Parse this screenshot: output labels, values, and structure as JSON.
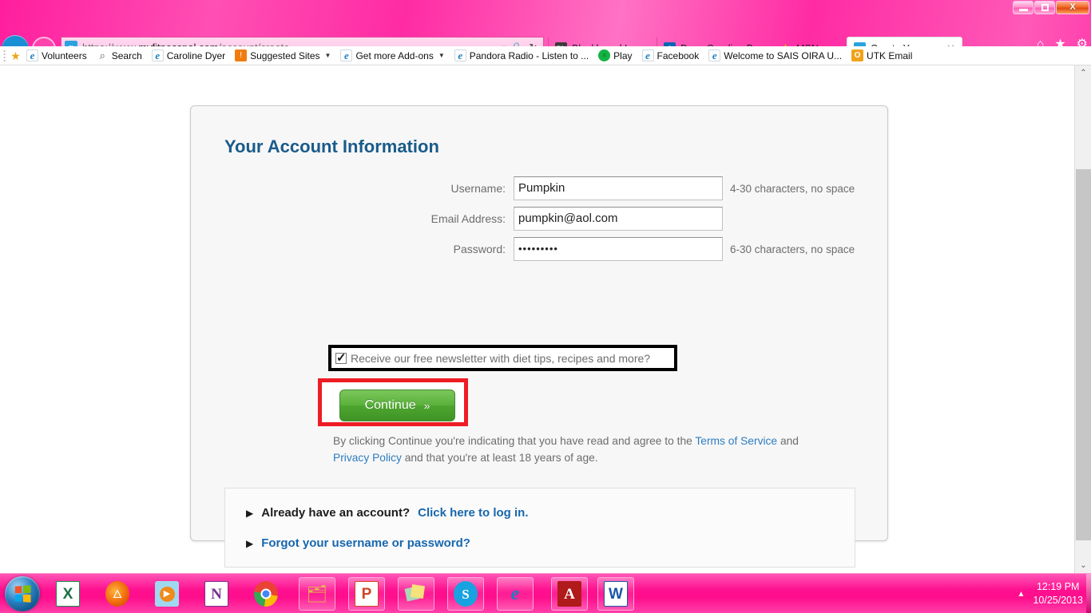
{
  "window": {
    "minimize_label": "Minimize",
    "maximize_label": "Restore",
    "close_label": "X"
  },
  "browser": {
    "back_label": "←",
    "forward_label": "→",
    "address": {
      "scheme": "https://www.",
      "host": "myfitnesspal.com",
      "path": "/account/create",
      "full": "https://www.myfitnesspal.com/account/create",
      "favicon_letter": "x",
      "search_icon": "⌕",
      "search_caret": "▼",
      "lock_icon": "🔒",
      "refresh_icon": "↻"
    },
    "tabs": [
      {
        "label": "Blackboard Learn",
        "favicon": "blackboard-icon",
        "favicon_letter": "Bb",
        "active": false
      },
      {
        "label": "Dyer, Caroline Beth ...",
        "favicon": "outlook-icon",
        "favicon_letter": "O",
        "active": false
      },
      {
        "label": "MSN.com",
        "favicon": "msn-butterfly-icon",
        "favicon_letter": "✦",
        "active": false
      },
      {
        "label": "Create Your Free ...",
        "favicon": "myfitnesspal-icon",
        "favicon_letter": "x",
        "active": true,
        "close_label": "✕"
      }
    ],
    "toolbar_icons": [
      {
        "name": "home-icon",
        "glyph": "⌂"
      },
      {
        "name": "favorites-star-icon",
        "glyph": "★"
      },
      {
        "name": "tools-gear-icon",
        "glyph": "⚙"
      }
    ],
    "bookmarks": [
      {
        "label": "Volunteers",
        "icon": "ie-page-icon",
        "glyph": "e",
        "icon_class": "ico-ie",
        "caret": false,
        "star": true
      },
      {
        "label": "Search",
        "icon": "magnifier-icon",
        "glyph": "⌕",
        "icon_class": "ico-mag",
        "caret": false
      },
      {
        "label": "Caroline Dyer",
        "icon": "ie-page-icon",
        "glyph": "e",
        "icon_class": "ico-ie",
        "caret": false
      },
      {
        "label": "Suggested Sites",
        "icon": "lightbulb-icon",
        "glyph": "!",
        "icon_class": "ico-bulb",
        "caret": true
      },
      {
        "label": "Get more Add-ons",
        "icon": "ie-page-icon",
        "glyph": "e",
        "icon_class": "ico-ie",
        "caret": true
      },
      {
        "label": "Pandora Radio - Listen to ...",
        "icon": "ie-page-icon",
        "glyph": "e",
        "icon_class": "ico-ie",
        "caret": false
      },
      {
        "label": "Play",
        "icon": "spotify-icon",
        "glyph": "≡",
        "icon_class": "ico-spot",
        "caret": false
      },
      {
        "label": "Facebook",
        "icon": "ie-page-icon",
        "glyph": "e",
        "icon_class": "ico-ie",
        "caret": false
      },
      {
        "label": "Welcome to SAIS  OIRA U...",
        "icon": "ie-page-icon",
        "glyph": "e",
        "icon_class": "ico-ie",
        "caret": false
      },
      {
        "label": "UTK Email",
        "icon": "outlook-icon",
        "glyph": "O",
        "icon_class": "ico-out",
        "caret": false
      }
    ]
  },
  "page": {
    "title": "Your Account Information",
    "fields": [
      {
        "label": "Username:",
        "value": "Pumpkin",
        "placeholder": "",
        "hint": "4-30 characters, no space",
        "name": "username"
      },
      {
        "label": "Email Address:",
        "value": "pumpkin@aol.com",
        "placeholder": "",
        "hint": "",
        "name": "email"
      },
      {
        "label": "Password:",
        "value": "•••••••••",
        "placeholder": "",
        "hint": "6-30 characters, no space",
        "name": "password"
      }
    ],
    "newsletter": {
      "label": "Receive our free newsletter with diet tips, recipes and more?",
      "checked": true,
      "check_glyph": "✓"
    },
    "continue_button": {
      "label": "Continue",
      "chevron": "»"
    },
    "terms": {
      "part1": "By clicking Continue you're indicating that you have read and agree to the ",
      "link1": "Terms of Service",
      "part2": " and ",
      "link2": "Privacy Policy",
      "part3": " and that you're at least 18 years of age."
    },
    "accordion": [
      {
        "triangle": "▶",
        "text": "Already have an account?",
        "link": "Click here to log in.",
        "name": "already-have-account"
      },
      {
        "triangle": "▶",
        "text": "",
        "link": "Forgot your username or password?",
        "name": "forgot-credentials"
      }
    ],
    "scrollbar": {
      "up_glyph": "⌃",
      "down_glyph": "⌄"
    },
    "colors": {
      "heading": "#1a5b8a",
      "link": "#2d7cc0",
      "button_green": "#4da52f",
      "annotation_red": "#ee1c25",
      "annotation_black": "#000000"
    }
  },
  "taskbar": {
    "start_label": "Start",
    "items": [
      {
        "name": "excel-icon",
        "glyph": "X",
        "color": "#1d7044",
        "bg": "#ffffff",
        "pinned": false
      },
      {
        "name": "firefox-icon",
        "glyph": "🦊",
        "color": "#e8730c",
        "bg": "transparent",
        "pinned": false
      },
      {
        "name": "windows-media-player-icon",
        "glyph": "▶",
        "color": "#ffffff",
        "bg": "#f08a1c",
        "pinned": false
      },
      {
        "name": "onenote-icon",
        "glyph": "N",
        "color": "#7a2f8f",
        "bg": "#ffffff",
        "pinned": false
      },
      {
        "name": "chrome-icon",
        "glyph": "◉",
        "color": "#1a73e8",
        "bg": "transparent",
        "pinned": false
      },
      {
        "name": "windows-explorer-icon",
        "glyph": "🗀",
        "color": "#d8a83a",
        "bg": "transparent",
        "pinned": true
      },
      {
        "name": "powerpoint-icon",
        "glyph": "P",
        "color": "#d04423",
        "bg": "#ffffff",
        "pinned": true
      },
      {
        "name": "sticky-notes-icon",
        "glyph": "▦",
        "color": "#e8c33a",
        "bg": "transparent",
        "pinned": true
      },
      {
        "name": "skype-icon",
        "glyph": "S",
        "color": "#ffffff",
        "bg": "#18a3e0",
        "pinned": true
      },
      {
        "name": "internet-explorer-icon",
        "glyph": "e",
        "color": "#1a7fc1",
        "bg": "transparent",
        "pinned": true
      },
      {
        "name": "adobe-reader-icon",
        "glyph": "A",
        "color": "#ffffff",
        "bg": "#b01a1a",
        "pinned": true
      },
      {
        "name": "word-icon",
        "glyph": "W",
        "color": "#1a56a8",
        "bg": "#ffffff",
        "pinned": true
      }
    ],
    "tray": {
      "show_hidden_icons": "▲",
      "time": "12:19 PM",
      "date": "10/25/2013"
    }
  }
}
